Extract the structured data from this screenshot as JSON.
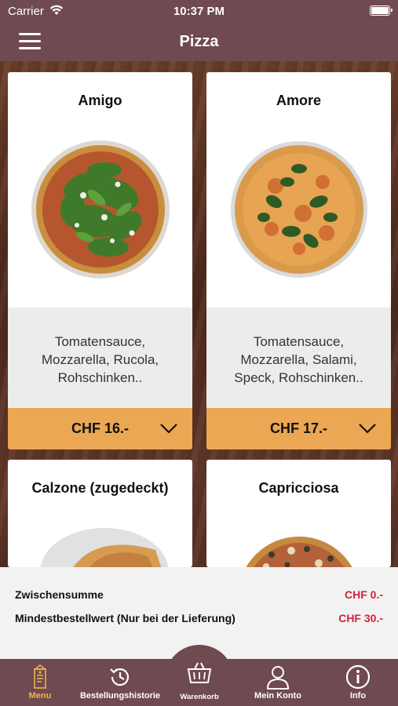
{
  "status": {
    "carrier": "Carrier",
    "time": "10:37 PM"
  },
  "nav": {
    "title": "Pizza"
  },
  "products": [
    {
      "name": "Amigo",
      "desc_lines": [
        "Tomatensauce,",
        "Mozzarella, Rucola,",
        "Rohschinken.."
      ],
      "price": "CHF 16.-"
    },
    {
      "name": "Amore",
      "desc_lines": [
        "Tomatensauce,",
        "Mozzarella, Salami,",
        "Speck, Rohschinken.."
      ],
      "price": "CHF 17.-"
    },
    {
      "name": "Calzone (zugedeckt)"
    },
    {
      "name": "Capricciosa"
    }
  ],
  "summary": {
    "subtotal_label": "Zwischensumme",
    "subtotal_value": "CHF 0.-",
    "minimum_label": "Mindestbestellwert (Nur bei der Lieferung)",
    "minimum_value": "CHF 30.-"
  },
  "tabs": {
    "menu": "Menu",
    "history": "Bestellungshistorie",
    "cart": "Warenkorb",
    "account": "Mein Konto",
    "info": "Info"
  },
  "colors": {
    "bar": "#6f4a51",
    "price_bar": "#eba753",
    "price_value": "#d61f3c",
    "active_tab": "#f0b34a"
  }
}
